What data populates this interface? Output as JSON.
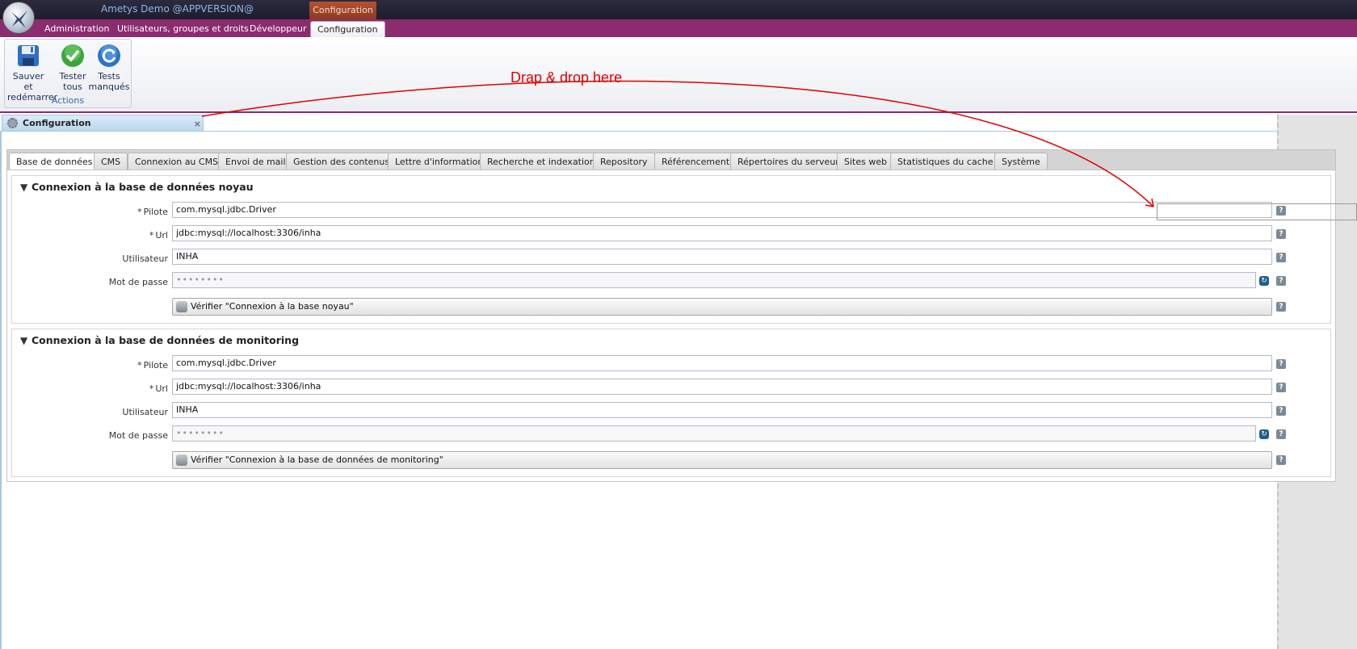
{
  "app": {
    "title": "Ametys Demo @APPVERSION@",
    "contextual_tab": "Configuration"
  },
  "main_tabs": [
    {
      "label": "Administration"
    },
    {
      "label": "Utilisateurs, groupes et droits"
    },
    {
      "label": "Développeur"
    },
    {
      "label": "Configuration",
      "active": true
    }
  ],
  "ribbon": {
    "group_label": "Actions",
    "buttons": [
      {
        "line1": "Sauver et",
        "line2": "redémarrer",
        "icon": "save-icon"
      },
      {
        "line1": "Tester",
        "line2": "tous",
        "icon": "check-icon"
      },
      {
        "line1": "Tests",
        "line2": "manqués",
        "icon": "retry-icon"
      }
    ]
  },
  "panel": {
    "title": "Configuration",
    "close": "×"
  },
  "annotation": {
    "text": "Drap & drop here",
    "color": "#e00000"
  },
  "config_tabs": [
    {
      "label": "Base de données",
      "active": true
    },
    {
      "label": "CMS"
    },
    {
      "label": "Connexion au CMS"
    },
    {
      "label": "Envoi de mail"
    },
    {
      "label": "Gestion des contenus"
    },
    {
      "label": "Lettre d'information"
    },
    {
      "label": "Recherche et indexation"
    },
    {
      "label": "Repository"
    },
    {
      "label": "Référencement"
    },
    {
      "label": "Répertoires du serveur"
    },
    {
      "label": "Sites web"
    },
    {
      "label": "Statistiques du cache"
    },
    {
      "label": "Système"
    }
  ],
  "sections": [
    {
      "title": "Connexion à la base de données noyau",
      "fields": [
        {
          "label": "Pilote",
          "required": "*",
          "value": "com.mysql.jdbc.Driver"
        },
        {
          "label": "Url",
          "required": "*",
          "value": "jdbc:mysql://localhost:3306/inha"
        },
        {
          "label": "Utilisateur",
          "value": "INHA"
        },
        {
          "label": "Mot de passe",
          "value": "••••••••"
        }
      ],
      "verify_label": "Vérifier \"Connexion à la base noyau\""
    },
    {
      "title": "Connexion à la base de données de monitoring",
      "fields": [
        {
          "label": "Pilote",
          "required": "*",
          "value": "com.mysql.jdbc.Driver"
        },
        {
          "label": "Url",
          "required": "*",
          "value": "jdbc:mysql://localhost:3306/inha"
        },
        {
          "label": "Utilisateur",
          "value": "INHA"
        },
        {
          "label": "Mot de passe",
          "value": "••••••••"
        }
      ],
      "verify_label": "Vérifier \"Connexion à la base de données de monitoring\""
    }
  ],
  "help_glyph": "?",
  "reset_glyph": "↻",
  "chevron_glyph": "⌄"
}
